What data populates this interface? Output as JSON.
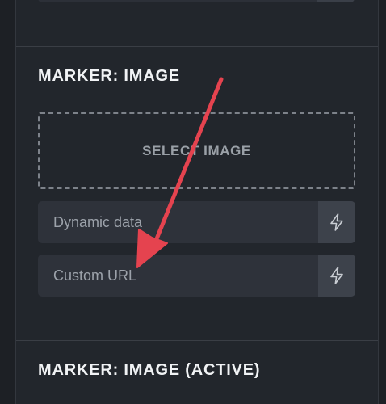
{
  "sections": {
    "marker_image": {
      "title": "MARKER: IMAGE",
      "select_image_label": "SELECT IMAGE",
      "dynamic_data_placeholder": "Dynamic data",
      "custom_url_placeholder": "Custom URL"
    },
    "marker_image_active": {
      "title": "MARKER: IMAGE (ACTIVE)"
    }
  },
  "icons": {
    "dynamic_data": "lightning-bolt-icon",
    "annotation": "red-arrow"
  },
  "colors": {
    "background": "#1d2025",
    "panel": "#22262c",
    "input": "#2e323a",
    "annotation_arrow": "#e5434f"
  }
}
